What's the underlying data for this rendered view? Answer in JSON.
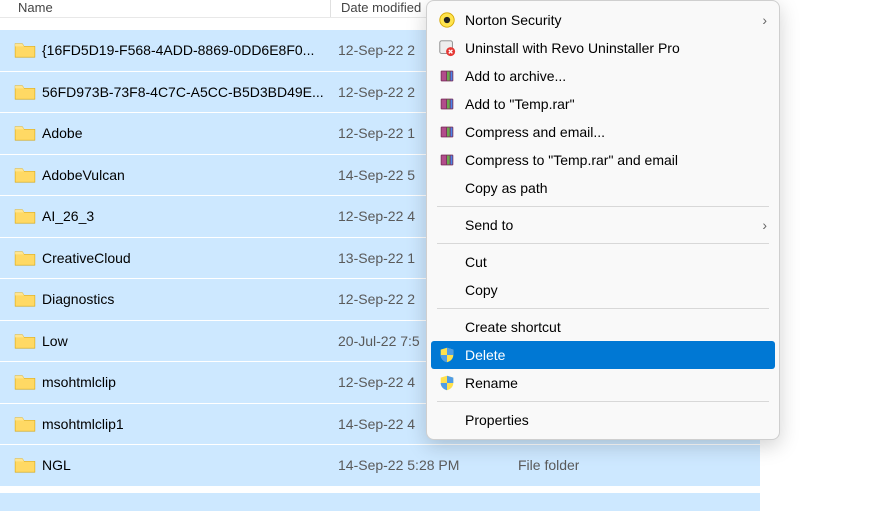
{
  "columns": {
    "name": "Name",
    "date": "Date modified"
  },
  "rows": [
    {
      "name": "{16FD5D19-F568-4ADD-8869-0DD6E8F0...",
      "date": "12-Sep-22 2",
      "type": ""
    },
    {
      "name": "56FD973B-73F8-4C7C-A5CC-B5D3BD49E...",
      "date": "12-Sep-22 2",
      "type": ""
    },
    {
      "name": "Adobe",
      "date": "12-Sep-22 1",
      "type": ""
    },
    {
      "name": "AdobeVulcan",
      "date": "14-Sep-22 5",
      "type": ""
    },
    {
      "name": "AI_26_3",
      "date": "12-Sep-22 4",
      "type": ""
    },
    {
      "name": "CreativeCloud",
      "date": "13-Sep-22 1",
      "type": ""
    },
    {
      "name": "Diagnostics",
      "date": "12-Sep-22 2",
      "type": ""
    },
    {
      "name": "Low",
      "date": "20-Jul-22 7:5",
      "type": ""
    },
    {
      "name": "msohtmlclip",
      "date": "12-Sep-22 4",
      "type": ""
    },
    {
      "name": "msohtmlclip1",
      "date": "14-Sep-22 4",
      "type": ""
    },
    {
      "name": "NGL",
      "date": "14-Sep-22 5:28 PM",
      "type": "File folder"
    }
  ],
  "menu": {
    "norton": "Norton Security",
    "revo": "Uninstall with Revo Uninstaller Pro",
    "archive": "Add to archive...",
    "addrar": "Add to \"Temp.rar\"",
    "compress": "Compress and email...",
    "compresstemp": "Compress to \"Temp.rar\" and email",
    "copypath": "Copy as path",
    "sendto": "Send to",
    "cut": "Cut",
    "copy": "Copy",
    "shortcut": "Create shortcut",
    "delete": "Delete",
    "rename": "Rename",
    "properties": "Properties"
  },
  "arrow": "›"
}
